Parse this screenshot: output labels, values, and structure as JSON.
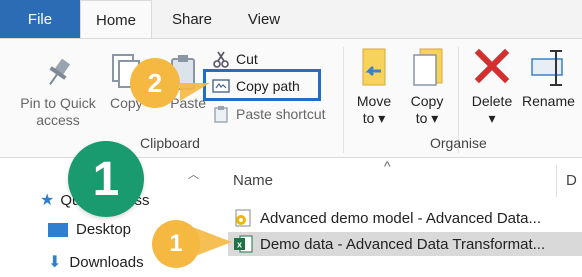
{
  "ribbon_tabs": {
    "file": "File",
    "home": "Home",
    "share": "Share",
    "view": "View"
  },
  "clipboard": {
    "pin": {
      "line1": "Pin to Quick",
      "line2": "access"
    },
    "copy": "Copy",
    "paste": "Paste",
    "cut": "Cut",
    "copy_path": "Copy path",
    "paste_shortcut": "Paste shortcut",
    "group_label": "Clipboard"
  },
  "organise": {
    "move": {
      "line1": "Move",
      "line2": "to"
    },
    "copy": {
      "line1": "Copy",
      "line2": "to"
    },
    "delete": "Delete",
    "rename": "Rename",
    "group_label": "Organise"
  },
  "annotations": {
    "step2": "2",
    "step1_big": "1",
    "step1_small": "1"
  },
  "nav": {
    "quick_access": "Quick access",
    "desktop": "Desktop",
    "downloads": "Downloads"
  },
  "list": {
    "column_name": "Name",
    "column_date": "D",
    "files": [
      {
        "name": "Advanced demo model - Advanced Data...",
        "type": "excel-macro",
        "selected": false
      },
      {
        "name": "Demo data - Advanced Data Transformat...",
        "type": "excel",
        "selected": true
      }
    ]
  },
  "colors": {
    "file_tab": "#2b6cb4",
    "highlight": "#1f6fc4",
    "badge_orange": "#f5b841",
    "badge_green": "#1a9a6f",
    "delete_red": "#d32f2f",
    "selected_row": "#d9d9d9"
  }
}
